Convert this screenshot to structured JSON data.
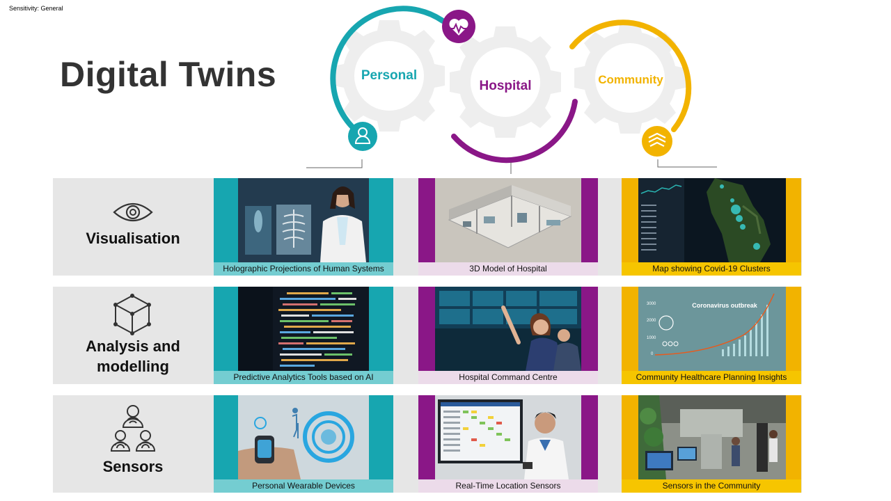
{
  "header": {
    "sensitivity": "Sensitivity: General",
    "title": "Digital Twins"
  },
  "gears": {
    "personal": "Personal",
    "hospital": "Hospital",
    "community": "Community"
  },
  "colors": {
    "personal": "#17a6b0",
    "hospital": "#8a1787",
    "community": "#f2b300",
    "gear": "#eeeeee",
    "band": "#e6e6e6"
  },
  "rows": [
    {
      "label": "Visualisation",
      "icon": "eye-icon",
      "captions": [
        "Holographic Projections of Human Systems",
        "3D Model of Hospital",
        "Map  showing Covid-19 Clusters"
      ]
    },
    {
      "label": "Analysis and modelling",
      "icon": "cube-icon",
      "captions": [
        "Predictive Analytics Tools based on AI",
        "Hospital Command Centre",
        "Community Healthcare Planning Insights"
      ]
    },
    {
      "label": "Sensors",
      "icon": "sensor-network-icon",
      "captions": [
        "Personal Wearable Devices",
        "Real-Time Location Sensors",
        "Sensors in the Community"
      ]
    }
  ],
  "images": {
    "outbreak_title": "Coronavirus outbreak",
    "outbreak_ticks": [
      "3000",
      "2000",
      "1000",
      "0"
    ]
  }
}
